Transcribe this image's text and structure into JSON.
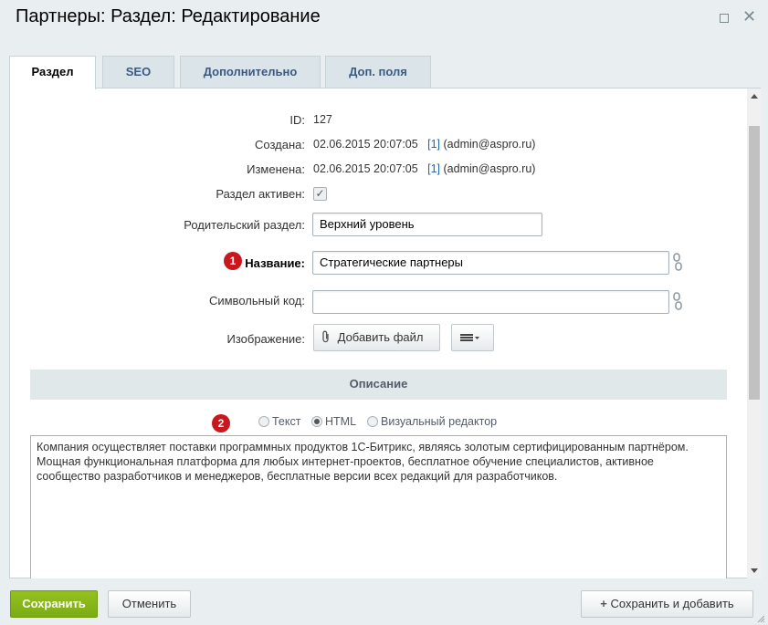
{
  "window": {
    "title": "Партнеры: Раздел: Редактирование"
  },
  "tabs": [
    {
      "label": "Раздел",
      "active": true
    },
    {
      "label": "SEO",
      "active": false
    },
    {
      "label": "Дополнительно",
      "active": false
    },
    {
      "label": "Доп. поля",
      "active": false
    }
  ],
  "fields": {
    "id_label": "ID:",
    "id_value": "127",
    "created_label": "Создана:",
    "created_date": "02.06.2015 20:07:05",
    "created_user_id": "[1]",
    "created_user_name": "(admin@aspro.ru)",
    "modified_label": "Изменена:",
    "modified_date": "02.06.2015 20:07:05",
    "modified_user_id": "[1]",
    "modified_user_name": "(admin@aspro.ru)",
    "active_label": "Раздел активен:",
    "active_checked": true,
    "parent_label": "Родительский раздел:",
    "parent_value": "Верхний уровень",
    "name_label": "Название:",
    "name_value": "Стратегические партнеры",
    "code_label": "Символьный код:",
    "code_value": "",
    "image_label": "Изображение:",
    "add_file_label": "Добавить файл"
  },
  "markers": {
    "first": "1",
    "second": "2"
  },
  "description": {
    "heading": "Описание",
    "modes": [
      {
        "label": "Текст",
        "selected": false
      },
      {
        "label": "HTML",
        "selected": true
      },
      {
        "label": "Визуальный редактор",
        "selected": false
      }
    ],
    "text_lines": [
      "Компания осуществляет поставки программных продуктов 1С-Битрикс, являясь золотым сертифицированным партнёром.",
      "Мощная функциональная платформа для любых интернет-проектов, бесплатное обучение специалистов, активное",
      "сообщество разработчиков и менеджеров, бесплатные версии всех редакций для разработчиков."
    ]
  },
  "footer": {
    "save_label": "Сохранить",
    "cancel_label": "Отменить",
    "save_add_label": "Сохранить и добавить"
  },
  "colors": {
    "accent_green": "#7bac14",
    "marker_red": "#c9171e",
    "tab_text": "#3b5a80",
    "link": "#2067b0"
  }
}
